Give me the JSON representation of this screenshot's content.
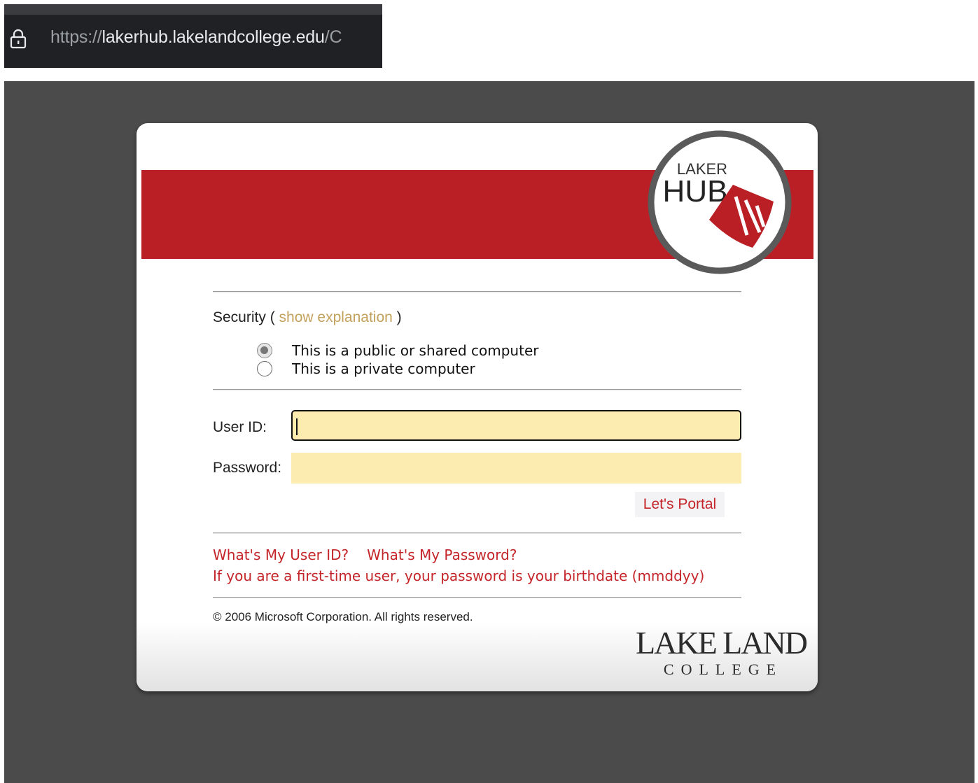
{
  "browser": {
    "url_scheme": "https://",
    "url_host": "lakerhub.lakelandcollege.edu",
    "url_path": "/C"
  },
  "logo": {
    "line1": "LAKER",
    "line2": "HUB"
  },
  "security": {
    "label": "Security",
    "open_paren": "(",
    "link": "show explanation",
    "close_paren": ")",
    "options": [
      {
        "label": "This is a public or shared computer",
        "selected": true
      },
      {
        "label": "This is a private computer",
        "selected": false
      }
    ]
  },
  "form": {
    "user_id_label": "User ID:",
    "user_id_value": "",
    "password_label": "Password:",
    "password_value": "",
    "submit_label": "Let's Portal"
  },
  "help": {
    "user_id_link": "What's My User ID?",
    "password_link": "What's My Password?",
    "first_time_note": "If you are a first-time user, your password is your birthdate (mmddyy)"
  },
  "footer": {
    "copyright": "© 2006 Microsoft Corporation. All rights reserved.",
    "college_name_line1": "LAKE LAND",
    "college_name_line2": "COLLEGE"
  },
  "colors": {
    "brand_red": "#b91f24",
    "link_red": "#c42529",
    "link_gold": "#c4a15c",
    "input_fill": "#fcecb0",
    "page_bg": "#4b4b4b"
  }
}
